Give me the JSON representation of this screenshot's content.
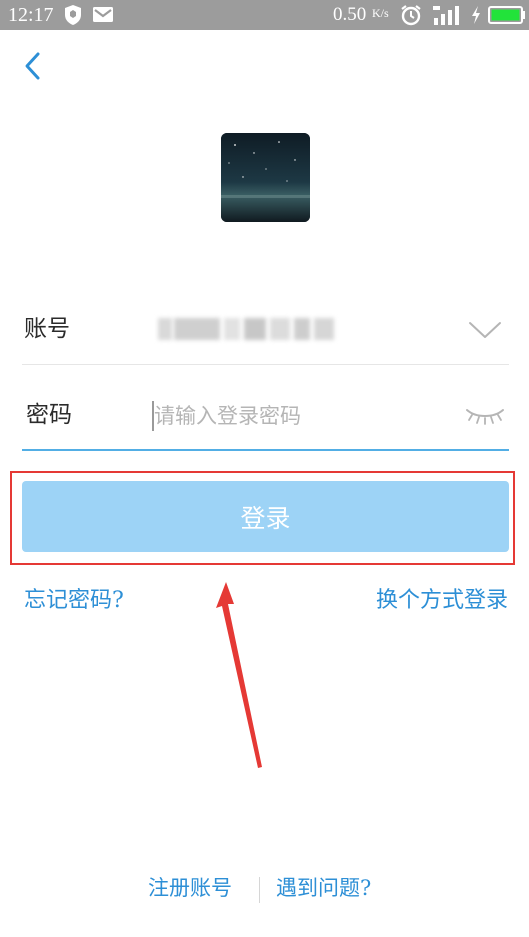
{
  "status_bar": {
    "time": "12:17",
    "net_speed": "0.50",
    "net_speed_unit": "K/s",
    "icons": [
      "shield-icon",
      "mail-icon",
      "alarm-icon",
      "signal-icon",
      "charging-icon",
      "battery-icon"
    ]
  },
  "login": {
    "account_label": "账号",
    "password_label": "密码",
    "password_placeholder": "请输入登录密码",
    "login_button": "登录",
    "forgot_password": "忘记密码?",
    "switch_method": "换个方式登录"
  },
  "footer": {
    "register": "注册账号",
    "help": "遇到问题?"
  },
  "colors": {
    "status_bar": "#9c9c9c",
    "link": "#2d8fd6",
    "login_button": "#9dd3f6",
    "focus_line": "#52aee5",
    "annotation": "#e53935"
  }
}
